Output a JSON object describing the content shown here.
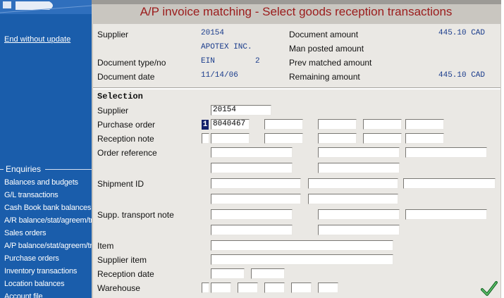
{
  "sidebar": {
    "end_without_update": "End without update",
    "enquiries_title": "Enquiries",
    "enquiries": [
      "Balances and budgets",
      "G/L transactions",
      "Cash Book bank balances",
      "A/R balance/stat/agreem/tran",
      "Sales orders",
      "A/P balance/stat/agreem/tran",
      "Purchase orders",
      "Inventory transactions",
      "Location balances",
      "Account file"
    ]
  },
  "title": "A/P invoice matching - Select goods reception transactions",
  "header": {
    "supplier_label": "Supplier",
    "supplier_no": "20154",
    "supplier_name": "APOTEX INC.",
    "doc_type_label": "Document type/no",
    "doc_type": "EIN",
    "doc_no": "2",
    "doc_date_label": "Document date",
    "doc_date": "11/14/06",
    "doc_amount_label": "Document amount",
    "doc_amount": "445.10 CAD",
    "man_posted_label": "Man posted amount",
    "prev_matched_label": "Prev matched amount",
    "remaining_label": "Remaining amount",
    "remaining_amount": "445.10 CAD"
  },
  "selection": {
    "title": "Selection",
    "supplier_label": "Supplier",
    "supplier_value": "20154",
    "purchase_order_label": "Purchase order",
    "purchase_order_line": "1",
    "purchase_order_value": "8040467",
    "reception_note_label": "Reception note",
    "order_reference_label": "Order reference",
    "shipment_id_label": "Shipment ID",
    "supp_transport_note_label": "Supp. transport note",
    "item_label": "Item",
    "supplier_item_label": "Supplier item",
    "reception_date_label": "Reception date",
    "warehouse_label": "Warehouse"
  },
  "colors": {
    "sidebar": "#1a5dab",
    "title": "#9b1b1b",
    "values": "#1a3c8c",
    "panel": "#eae8e4"
  }
}
